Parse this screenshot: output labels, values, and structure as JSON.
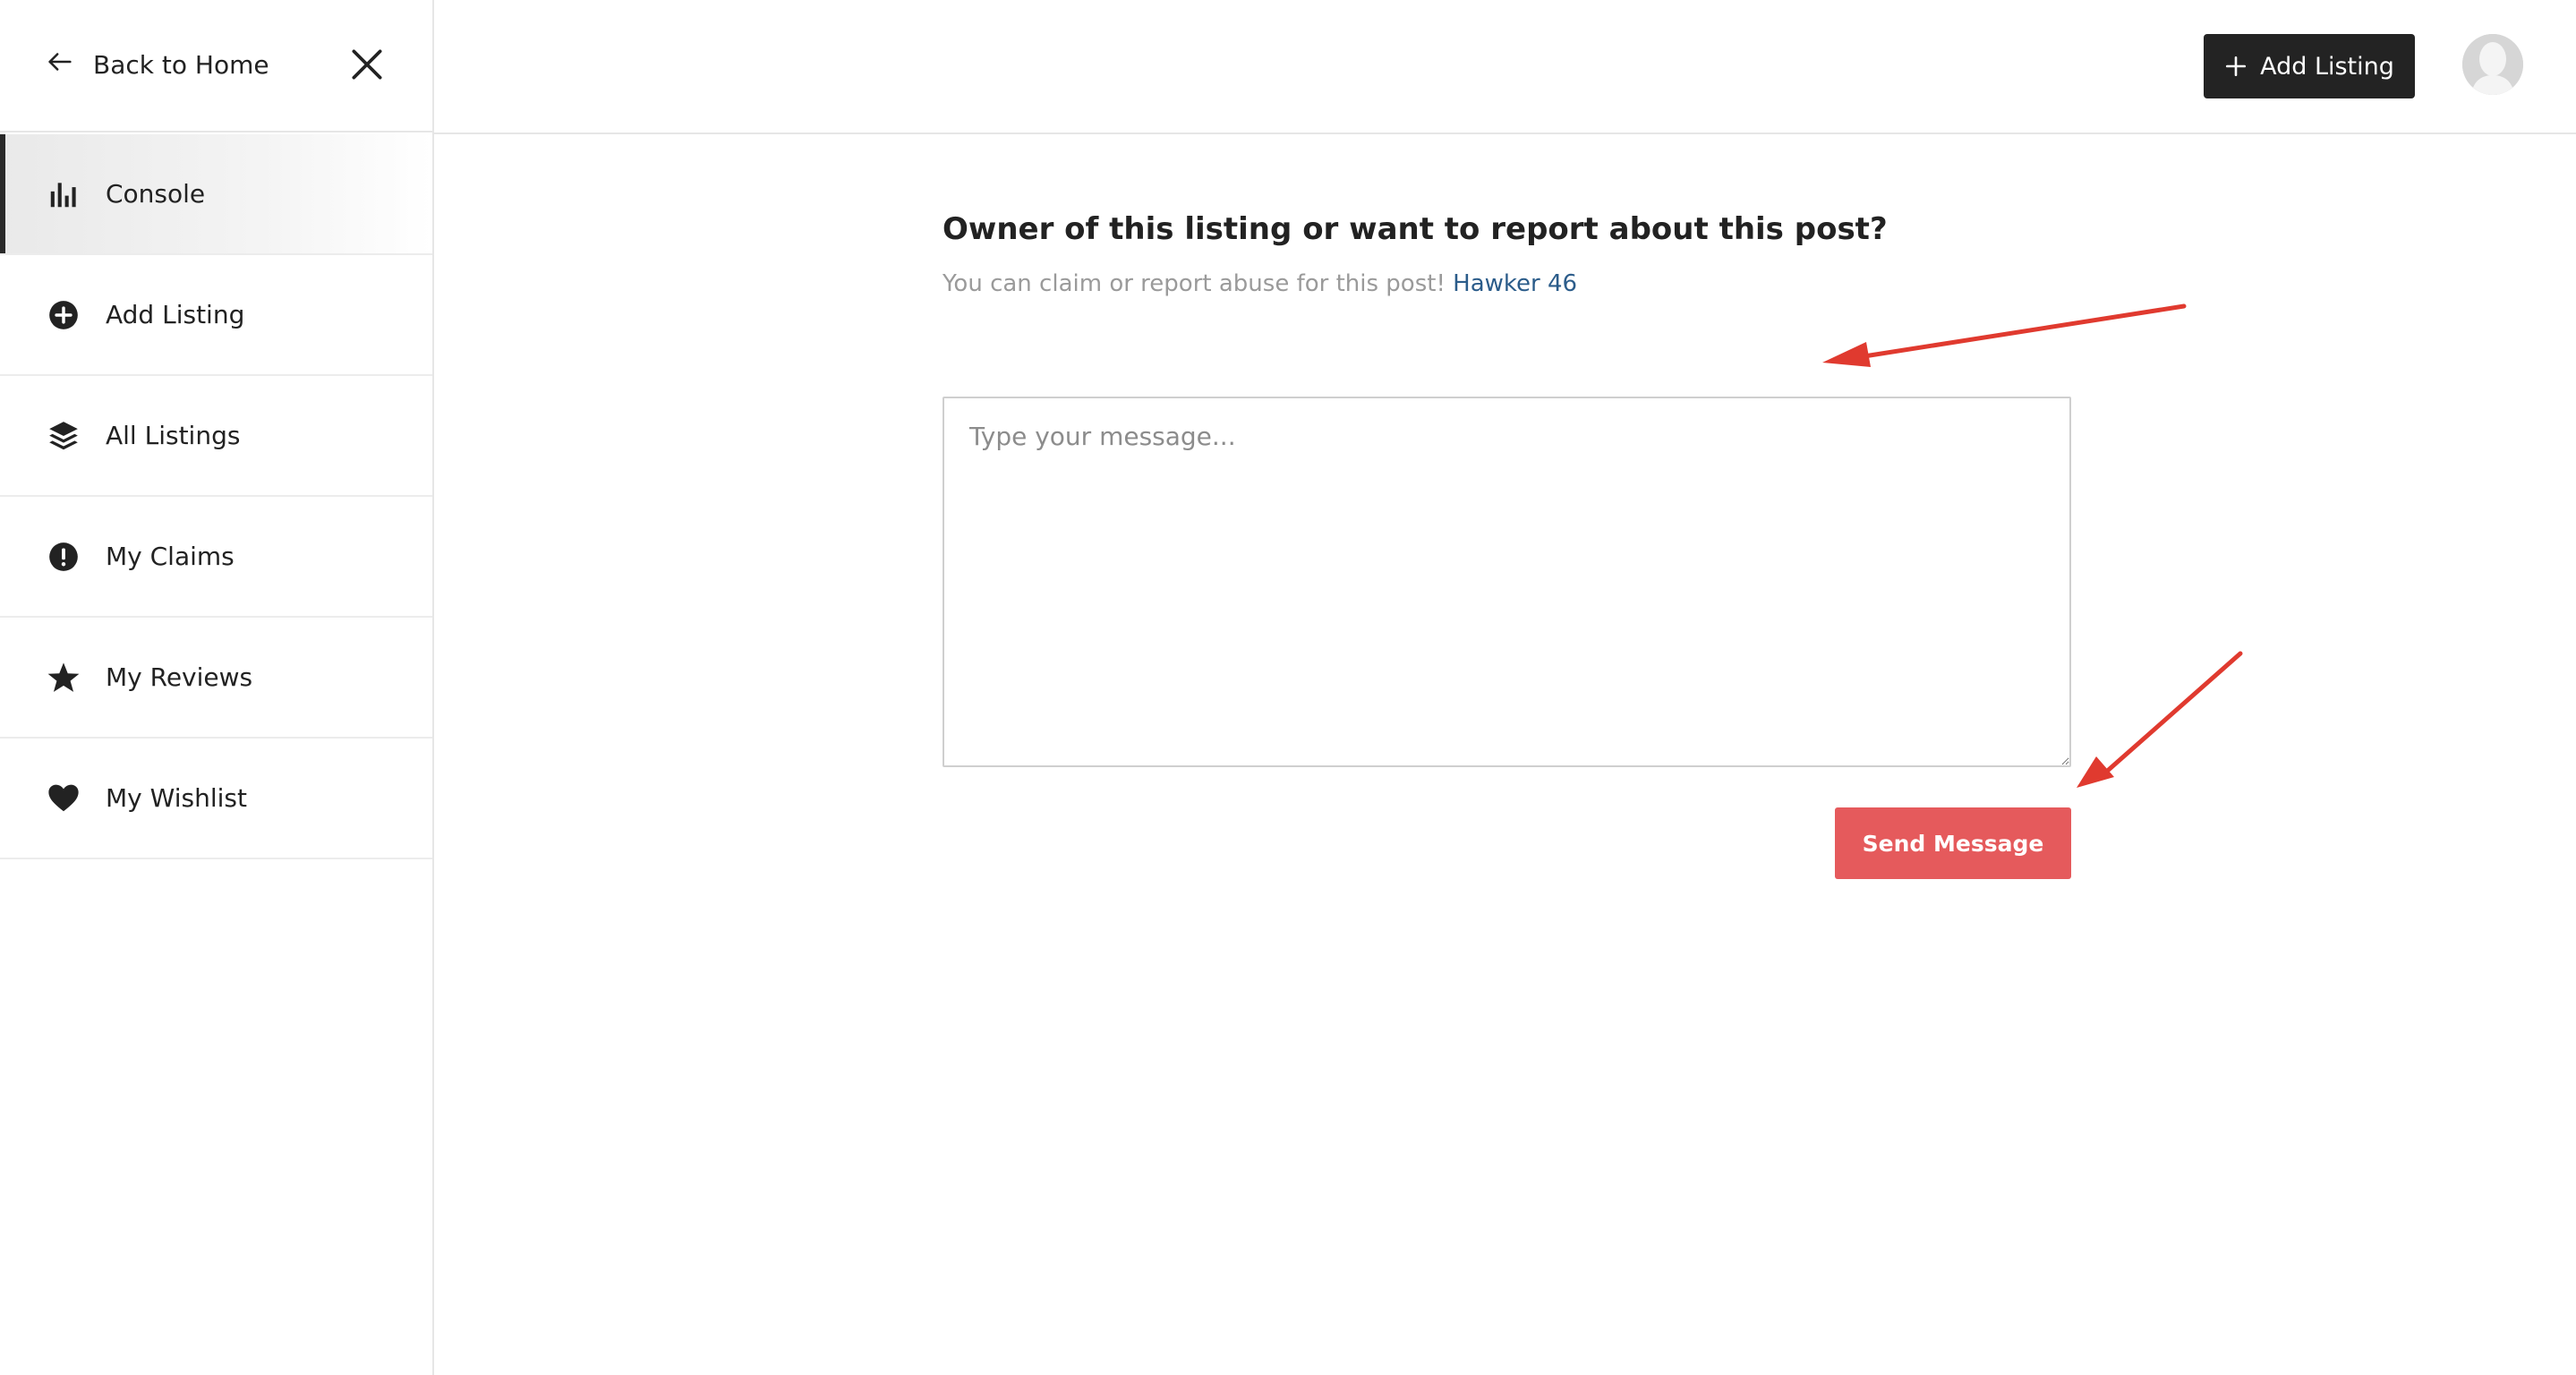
{
  "sidebar": {
    "back_label": "Back to Home",
    "items": [
      {
        "label": "Console",
        "icon": "bar-chart-icon",
        "active": true
      },
      {
        "label": "Add Listing",
        "icon": "plus-circle-icon",
        "active": false
      },
      {
        "label": "All Listings",
        "icon": "layers-icon",
        "active": false
      },
      {
        "label": "My Claims",
        "icon": "exclamation-circle-icon",
        "active": false
      },
      {
        "label": "My Reviews",
        "icon": "star-icon",
        "active": false
      },
      {
        "label": "My Wishlist",
        "icon": "heart-icon",
        "active": false
      }
    ]
  },
  "topbar": {
    "add_listing_label": "Add Listing"
  },
  "main": {
    "title": "Owner of this listing or want to report about this post?",
    "subtitle": "You can claim or report abuse for this post!",
    "listing_name": "Hawker 46",
    "message_placeholder": "Type your message...",
    "message_value": "",
    "send_label": "Send Message"
  },
  "colors": {
    "send_button": "#e55a5c",
    "add_listing_button": "#232323",
    "link": "#2b5c8a",
    "annotation_arrow": "#e03a2f"
  }
}
